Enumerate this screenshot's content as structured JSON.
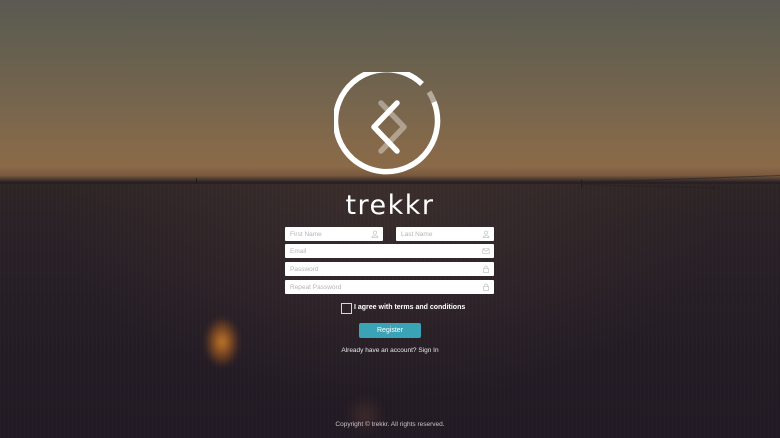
{
  "brand": {
    "name": "trekkr",
    "logo_icon": "trekkr-logo-icon"
  },
  "colors": {
    "accent": "#3aa3b6",
    "text": "#ffffff"
  },
  "form": {
    "first_name": {
      "placeholder": "First Name",
      "value": "",
      "icon": "user-icon"
    },
    "last_name": {
      "placeholder": "Last Name",
      "value": "",
      "icon": "user-icon"
    },
    "email": {
      "placeholder": "Email",
      "value": "",
      "icon": "envelope-icon"
    },
    "password": {
      "placeholder": "Password",
      "value": "",
      "icon": "lock-icon"
    },
    "repeat_password": {
      "placeholder": "Repeat Password",
      "value": "",
      "icon": "lock-icon"
    },
    "terms_label": "I agree with terms and conditions",
    "terms_checked": false,
    "register_label": "Register"
  },
  "signin": {
    "prompt": "Already have an account?",
    "link_label": "Sign In"
  },
  "footer": {
    "copyright": "Copyright © trekkr. All rights reserved."
  }
}
